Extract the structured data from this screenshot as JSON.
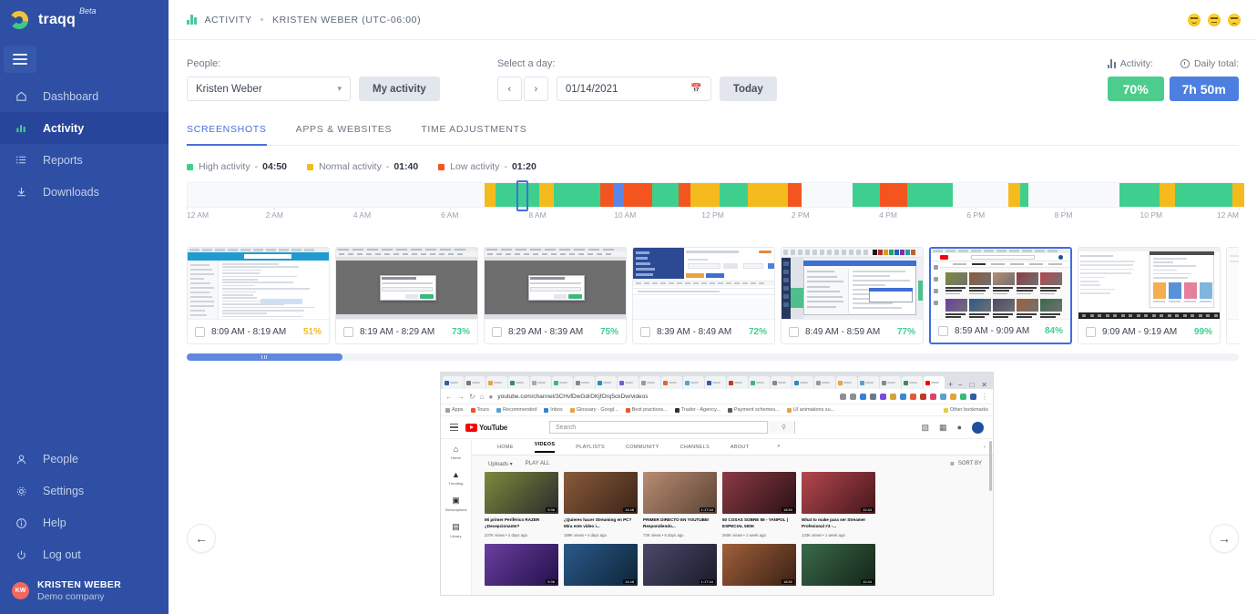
{
  "sidebar": {
    "brand": {
      "name": "traqq",
      "beta": "Beta"
    },
    "menu_icon": "hamburger-icon",
    "items": [
      {
        "label": "Dashboard",
        "icon": "home-icon",
        "active": false
      },
      {
        "label": "Activity",
        "icon": "bar-chart-icon",
        "active": true
      },
      {
        "label": "Reports",
        "icon": "list-icon",
        "active": false
      },
      {
        "label": "Downloads",
        "icon": "download-icon",
        "active": false
      }
    ],
    "bottom_items": [
      {
        "label": "People",
        "icon": "user-icon"
      },
      {
        "label": "Settings",
        "icon": "gear-icon"
      },
      {
        "label": "Help",
        "icon": "info-icon"
      },
      {
        "label": "Log out",
        "icon": "power-icon"
      }
    ],
    "user": {
      "initials": "KW",
      "name": "KRISTEN WEBER",
      "company": "Demo company"
    }
  },
  "topbar": {
    "section": "ACTIVITY",
    "separator": "•",
    "user": "KRISTEN WEBER (UTC-06:00)",
    "moods": [
      "happy-face",
      "neutral-face",
      "sad-face"
    ]
  },
  "filters": {
    "people_label": "People:",
    "people_value": "Kristen Weber",
    "my_activity_label": "My activity",
    "day_label": "Select a day:",
    "prev_label": "‹",
    "next_label": "›",
    "date_value": "01/14/2021",
    "today_label": "Today"
  },
  "stats": {
    "activity_label": "Activity:",
    "daily_total_label": "Daily total:",
    "activity_value": "70%",
    "daily_total_value": "7h 50m",
    "activity_color": "#4ccd8d",
    "total_color": "#4c7fe0"
  },
  "tabs": [
    {
      "label": "SCREENSHOTS",
      "active": true
    },
    {
      "label": "APPS & WEBSITES",
      "active": false
    },
    {
      "label": "TIME ADJUSTMENTS",
      "active": false
    }
  ],
  "legend": [
    {
      "label": "High activity",
      "dash": "-",
      "value": "04:50",
      "color": "#3ecf8e"
    },
    {
      "label": "Normal activity",
      "dash": "-",
      "value": "01:40",
      "color": "#f5bb1d"
    },
    {
      "label": "Low activity",
      "dash": "-",
      "value": "01:20",
      "color": "#f4551f"
    }
  ],
  "timeline": {
    "ticks": [
      "12 AM",
      "2 AM",
      "4 AM",
      "6 AM",
      "8 AM",
      "10 AM",
      "12 PM",
      "2 PM",
      "4 PM",
      "6 PM",
      "8 PM",
      "10 PM",
      "12 AM"
    ],
    "cursor_percent": 37.6,
    "cursor_width_percent": 1.3,
    "segments": [
      {
        "start": 33.9,
        "width": 1.3,
        "color": "#f5bb1d"
      },
      {
        "start": 35.2,
        "width": 5.0,
        "color": "#3ecf8e"
      },
      {
        "start": 40.2,
        "width": 1.6,
        "color": "#f5bb1d"
      },
      {
        "start": 41.8,
        "width": 5.3,
        "color": "#3ecf8e"
      },
      {
        "start": 47.1,
        "width": 1.5,
        "color": "#f4551f"
      },
      {
        "start": 48.6,
        "width": 1.3,
        "color": "#5b86e5"
      },
      {
        "start": 49.9,
        "width": 3.2,
        "color": "#f4551f"
      },
      {
        "start": 53.1,
        "width": 3.0,
        "color": "#3ecf8e"
      },
      {
        "start": 56.1,
        "width": 1.4,
        "color": "#f4551f"
      },
      {
        "start": 57.5,
        "width": 3.3,
        "color": "#f5bb1d"
      },
      {
        "start": 60.8,
        "width": 3.2,
        "color": "#3ecf8e"
      },
      {
        "start": 64.0,
        "width": 4.6,
        "color": "#f5bb1d"
      },
      {
        "start": 68.6,
        "width": 1.5,
        "color": "#f4551f"
      },
      {
        "start": 76.0,
        "width": 3.1,
        "color": "#3ecf8e"
      },
      {
        "start": 79.1,
        "width": 3.1,
        "color": "#f4551f"
      },
      {
        "start": 82.2,
        "width": 5.2,
        "color": "#3ecf8e"
      },
      {
        "start": 93.8,
        "width": 1.3,
        "color": "#f5bb1d"
      },
      {
        "start": 95.1,
        "width": 1.0,
        "color": "#3ecf8e"
      },
      {
        "start": 106.5,
        "width": 4.6,
        "color": "#3ecf8e"
      },
      {
        "start": 111.1,
        "width": 1.7,
        "color": "#f5bb1d"
      },
      {
        "start": 112.8,
        "width": 6.6,
        "color": "#3ecf8e"
      },
      {
        "start": 119.4,
        "width": 1.3,
        "color": "#f5bb1d"
      }
    ]
  },
  "screenshots": [
    {
      "time": "8:09 AM - 8:19 AM",
      "percent": "51%",
      "percent_color": "#f5bb1d",
      "selected": false,
      "kind": "doc-page"
    },
    {
      "time": "8:19 AM - 8:29 AM",
      "percent": "73%",
      "percent_color": "#3ecf8e",
      "selected": false,
      "kind": "grey-dialog"
    },
    {
      "time": "8:29 AM - 8:39 AM",
      "percent": "75%",
      "percent_color": "#3ecf8e",
      "selected": false,
      "kind": "grey-dialog"
    },
    {
      "time": "8:39 AM - 8:49 AM",
      "percent": "72%",
      "percent_color": "#3ecf8e",
      "selected": false,
      "kind": "blue-form"
    },
    {
      "time": "8:49 AM - 8:59 AM",
      "percent": "77%",
      "percent_color": "#3ecf8e",
      "selected": false,
      "kind": "ide-window"
    },
    {
      "time": "8:59 AM - 9:09 AM",
      "percent": "84%",
      "percent_color": "#3ecf8e",
      "selected": true,
      "kind": "youtube"
    },
    {
      "time": "9:09 AM - 9:19 AM",
      "percent": "99%",
      "percent_color": "#3ecf8e",
      "selected": false,
      "kind": "shopping"
    }
  ],
  "scrollbar": {
    "thumb_percent": 14.8,
    "position_percent": 0
  },
  "preview": {
    "prev_arrow": "←",
    "next_arrow": "→",
    "browser": {
      "url": "youtube.com/channel/3CHvfDwGdrDKjfOrq5ckDw/videos",
      "new_tab": "+",
      "win_min": "−",
      "win_max": "□",
      "win_close": "✕",
      "back": "←",
      "forward": "→",
      "reload": "↻",
      "home": "⌂",
      "lock": "●",
      "menu": "⋮",
      "bookmarks": [
        "Apps",
        "Tours",
        "Recommended",
        "Inbox",
        "Glossary - Googl...",
        "Best practices...",
        "Trader - Agency...",
        "Payment schemes...",
        "UI animations su...",
        "Other bookmarks"
      ]
    },
    "youtube": {
      "search_placeholder": "Search",
      "search_icon": "magnifier-icon",
      "channel_tabs": [
        "HOME",
        "VIDEOS",
        "PLAYLISTS",
        "COMMUNITY",
        "CHANNELS",
        "ABOUT"
      ],
      "channel_tab_active": "VIDEOS",
      "rail": [
        {
          "label": "Home",
          "icon": "home-icon"
        },
        {
          "label": "Trending",
          "icon": "flame-icon"
        },
        {
          "label": "Subscriptions",
          "icon": "subscriptions-icon"
        },
        {
          "label": "Library",
          "icon": "library-icon"
        }
      ],
      "uploads_label": "Uploads",
      "play_all_label": "PLAY ALL",
      "sort_by_label": "SORT BY",
      "videos": [
        {
          "title": "Mi primer Periférico RAZER ¿Decepcionante?",
          "meta": "237K views • 2 days ago",
          "duration": "9:36",
          "c1": "#7d8a3d",
          "c2": "#2b2b2b"
        },
        {
          "title": "¿Quieres hacer Streaming en PC? Mira este video i...",
          "meta": "189K views • 4 days ago",
          "duration": "14:48",
          "c1": "#8a5a3a",
          "c2": "#3a2418"
        },
        {
          "title": "PRIMER DIRECTO EN YOUTUBE! Respondiendo...",
          "meta": "73K views • 6 days ago",
          "duration": "1:17:44",
          "c1": "#b98c72",
          "c2": "#5c4336"
        },
        {
          "title": "50 COSAS SOBRE MI - YANPOL | ESPECIAL 500K",
          "meta": "260K views • 1 week ago",
          "duration": "18:50",
          "c1": "#8c3b45",
          "c2": "#2a1014"
        },
        {
          "title": "What to make para ser Streamer Profesional #3 -...",
          "meta": "133K views • 1 week ago",
          "duration": "12:44",
          "c1": "#b4484f",
          "c2": "#45161b"
        }
      ]
    }
  }
}
